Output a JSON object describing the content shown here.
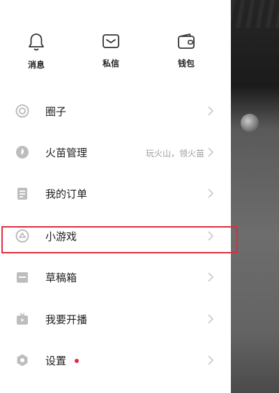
{
  "top": [
    {
      "label": "消息",
      "icon": "bell-icon"
    },
    {
      "label": "私信",
      "icon": "mail-icon"
    },
    {
      "label": "钱包",
      "icon": "wallet-icon"
    }
  ],
  "menu": [
    {
      "label": "圈子",
      "icon": "circle-icon"
    },
    {
      "label": "火苗管理",
      "icon": "flame-icon",
      "sub": "玩火山，领火苗"
    },
    {
      "label": "我的订单",
      "icon": "order-icon"
    },
    {
      "label": "小游戏",
      "icon": "game-icon"
    },
    {
      "label": "草稿箱",
      "icon": "drafts-icon"
    },
    {
      "label": "我要开播",
      "icon": "broadcast-icon"
    },
    {
      "label": "设置",
      "icon": "settings-icon",
      "badge": "notification-dot"
    }
  ],
  "colors": {
    "highlight": "#e02b3c",
    "badge": "#e8263a",
    "icon": "#bdbdbd"
  }
}
